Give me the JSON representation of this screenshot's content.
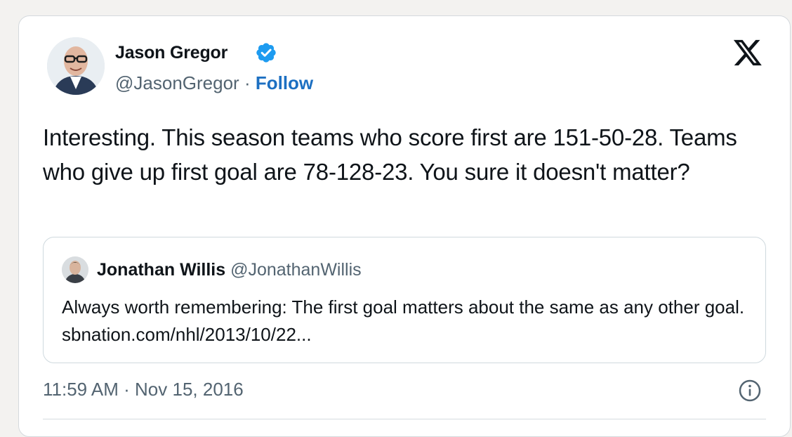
{
  "author": {
    "name": "Jason Gregor",
    "handle": "@JasonGregor",
    "separator": "·",
    "follow_label": "Follow",
    "verified": true
  },
  "tweet": {
    "text": "Interesting. This season teams who score first are 151-50-28. Teams who give up first goal are 78-128-23. You sure it doesn't matter?",
    "timestamp": "11:59 AM · Nov 15, 2016"
  },
  "quoted_tweet": {
    "name": "Jonathan Willis",
    "handle": "@JonathanWillis",
    "text": "Always worth remembering: The first goal matters about the same as any other goal. sbnation.com/nhl/2013/10/22..."
  },
  "icons": {
    "verified": "verified-badge-icon",
    "platform": "x-logo-icon",
    "info": "info-icon"
  },
  "colors": {
    "follow": "#1d70c2",
    "verified": "#1d9bf0",
    "secondary_text": "#536471",
    "primary_text": "#0f1419"
  }
}
